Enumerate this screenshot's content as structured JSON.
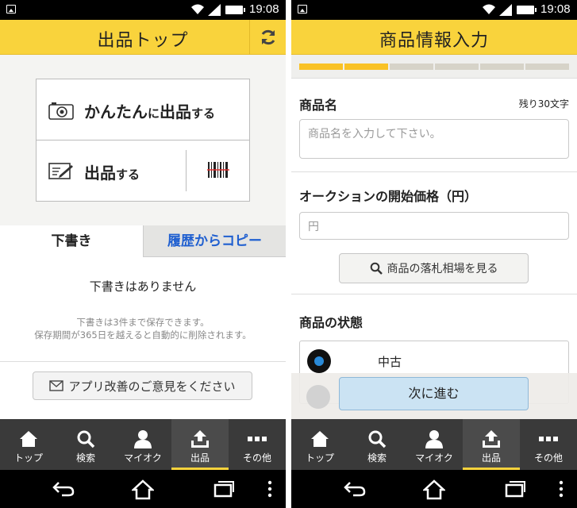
{
  "status_bar": {
    "time": "19:08"
  },
  "left": {
    "header_title": "出品トップ",
    "quick_sell": {
      "main": "かんたん",
      "mid": "に",
      "main2": "出品",
      "tail": "する"
    },
    "sell": {
      "main": "出品",
      "tail": "する"
    },
    "tabs": {
      "drafts": "下書き",
      "copy_history": "履歴からコピー"
    },
    "empty_title": "下書きはありません",
    "empty_note_1": "下書きは3件まで保存できます。",
    "empty_note_2": "保存期間が365日を越えると自動的に削除されます。",
    "feedback_label": "アプリ改善のご意見をください"
  },
  "right": {
    "header_title": "商品情報入力",
    "progress": {
      "total_steps": 6,
      "completed_steps": 2
    },
    "product_name_label": "商品名",
    "remaining": "残り30文字",
    "product_name_placeholder": "商品名を入力して下さい。",
    "start_price_label": "オークションの開始価格（円）",
    "price_placeholder": "円",
    "market_button": "商品の落札相場を見る",
    "condition_label": "商品の状態",
    "condition_selected": "中古",
    "next_button": "次に進む"
  },
  "tabbar": {
    "items": [
      {
        "label": "トップ",
        "icon": "home-icon"
      },
      {
        "label": "検索",
        "icon": "search-icon"
      },
      {
        "label": "マイオク",
        "icon": "person-icon"
      },
      {
        "label": "出品",
        "icon": "upload-tray-icon"
      },
      {
        "label": "その他",
        "icon": "more-icon"
      }
    ],
    "active_index": 3
  },
  "colors": {
    "header": "#f9d33c",
    "link": "#1f5fd0",
    "tabbar": "#3a3a3a",
    "progress_on": "#f9c225",
    "next_button": "#cbe3f3"
  }
}
